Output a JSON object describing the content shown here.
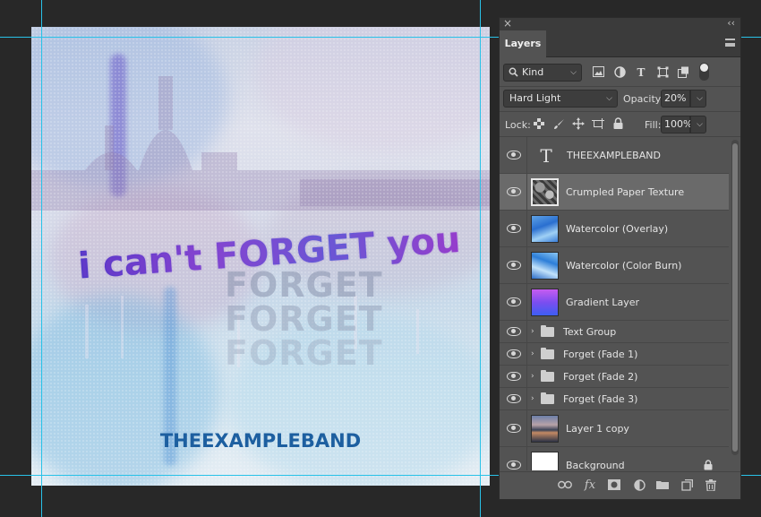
{
  "canvas": {
    "headline": "i can't FORGET you",
    "fade_words": [
      "FORGET",
      "FORGET",
      "FORGET"
    ],
    "band_name": "THEEXAMPLEBAND",
    "guide_color": "#29c2e8"
  },
  "panel": {
    "close_glyph": "×",
    "collapse_glyph": "‹‹",
    "tab": "Layers",
    "filter": {
      "kind_label": "Kind"
    },
    "blend_mode": "Hard Light",
    "opacity_label": "Opacity:",
    "opacity_value": "20%",
    "lock_label": "Lock:",
    "fill_label": "Fill:",
    "fill_value": "100%",
    "layers": [
      {
        "name": "THEEXAMPLEBAND",
        "type": "text"
      },
      {
        "name": "Crumpled Paper Texture",
        "type": "image",
        "active": true
      },
      {
        "name": "Watercolor (Overlay)",
        "type": "image"
      },
      {
        "name": "Watercolor (Color Burn)",
        "type": "image"
      },
      {
        "name": "Gradient Layer",
        "type": "gradient"
      },
      {
        "name": "Text Group",
        "type": "group"
      },
      {
        "name": "Forget (Fade 1)",
        "type": "group"
      },
      {
        "name": "Forget (Fade 2)",
        "type": "group"
      },
      {
        "name": "Forget (Fade 3)",
        "type": "group"
      },
      {
        "name": "Layer 1 copy",
        "type": "image"
      },
      {
        "name": "Background",
        "type": "background",
        "locked": true
      }
    ]
  },
  "icons": {
    "text_layer": "T",
    "caret": "›"
  }
}
